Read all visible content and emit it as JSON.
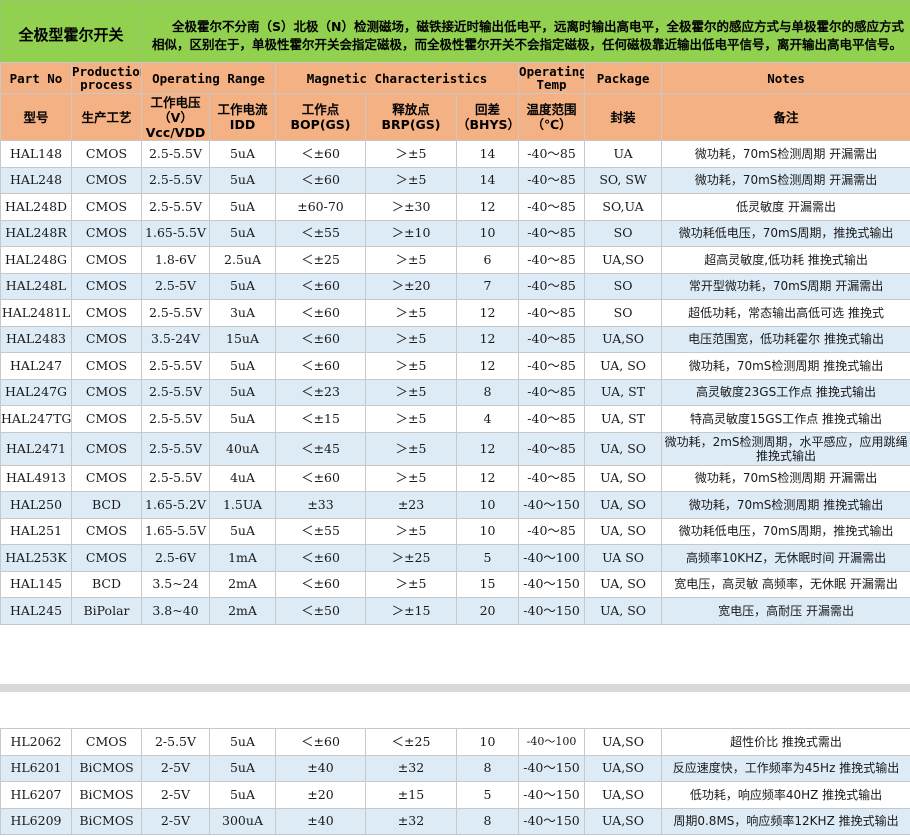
{
  "title": "全极型霍尔开关",
  "description": "全极霍尔不分南（S）北极（N）检测磁场，磁铁接近时输出低电平，远离时输出高电平，全极霍尔的感应方式与单极霍尔的感应方式相似，区别在于，单极性霍尔开关会指定磁极，而全极性霍尔开关不会指定磁极，任何磁极靠近输出低电平信号，离开输出高电平信号。",
  "header_en": {
    "part_no": "Part No",
    "production": "Production process",
    "operating_range": "Operating Range",
    "magnetic": "Magnetic Characteristics",
    "operating_temp": "Operating Temp",
    "package": "Package",
    "notes": "Notes"
  },
  "header_cn": {
    "part_no": "型号",
    "production": "生产工艺",
    "voltage": "工作电压（V）Vcc/VDD",
    "current": "工作电流IDD",
    "bop": "工作点BOP(GS)",
    "brp": "释放点BRP(GS)",
    "hys": "回差（BHYS）",
    "temp": "温度范围（℃）",
    "package": "封装",
    "notes": "备注"
  },
  "rows": [
    {
      "part": "HAL148",
      "proc": "CMOS",
      "volt": "2.5-5.5V",
      "curr": "5uA",
      "bop": "＜±60",
      "brp": "＞±5",
      "hys": "14",
      "temp": "-40～85",
      "pkg": "UA",
      "notes": "微功耗，70mS检测周期 开漏需出"
    },
    {
      "part": "HAL248",
      "proc": "CMOS",
      "volt": "2.5-5.5V",
      "curr": "5uA",
      "bop": "＜±60",
      "brp": "＞±5",
      "hys": "14",
      "temp": "-40～85",
      "pkg": "SO, SW",
      "notes": "微功耗，70mS检测周期 开漏需出"
    },
    {
      "part": "HAL248D",
      "proc": "CMOS",
      "volt": "2.5-5.5V",
      "curr": "5uA",
      "bop": "±60-70",
      "brp": "＞±30",
      "hys": "12",
      "temp": "-40～85",
      "pkg": "SO,UA",
      "notes": "低灵敏度  开漏需出"
    },
    {
      "part": "HAL248R",
      "proc": "CMOS",
      "volt": "1.65-5.5V",
      "curr": "5uA",
      "bop": "＜±55",
      "brp": "＞±10",
      "hys": "10",
      "temp": "-40～85",
      "pkg": "SO",
      "notes": "微功耗低电压，70mS周期，推挽式输出"
    },
    {
      "part": "HAL248G",
      "proc": "CMOS",
      "volt": "1.8-6V",
      "curr": "2.5uA",
      "bop": "＜±25",
      "brp": "＞±5",
      "hys": "6",
      "temp": "-40～85",
      "pkg": "UA,SO",
      "notes": "超高灵敏度,低功耗 推挽式输出"
    },
    {
      "part": "HAL248L",
      "proc": "CMOS",
      "volt": "2.5-5V",
      "curr": "5uA",
      "bop": "＜±60",
      "brp": "＞±20",
      "hys": "7",
      "temp": "-40～85",
      "pkg": "SO",
      "notes": "常开型微功耗，70mS周期 开漏需出"
    },
    {
      "part": "HAL2481L",
      "proc": "CMOS",
      "volt": "2.5-5.5V",
      "curr": "3uA",
      "bop": "＜±60",
      "brp": "＞±5",
      "hys": "12",
      "temp": "-40～85",
      "pkg": "SO",
      "notes": "超低功耗，常态输出高低可选 推挽式"
    },
    {
      "part": "HAL2483",
      "proc": "CMOS",
      "volt": "3.5-24V",
      "curr": "15uA",
      "bop": "＜±60",
      "brp": "＞±5",
      "hys": "12",
      "temp": "-40～85",
      "pkg": "UA,SO",
      "notes": "电压范围宽，低功耗霍尔 推挽式输出"
    },
    {
      "part": "HAL247",
      "proc": "CMOS",
      "volt": "2.5-5.5V",
      "curr": "5uA",
      "bop": "＜±60",
      "brp": "＞±5",
      "hys": "12",
      "temp": "-40～85",
      "pkg": "UA, SO",
      "notes": "微功耗，70mS检测周期 推挽式输出"
    },
    {
      "part": "HAL247G",
      "proc": "CMOS",
      "volt": "2.5-5.5V",
      "curr": "5uA",
      "bop": "＜±23",
      "brp": "＞±5",
      "hys": "8",
      "temp": "-40～85",
      "pkg": "UA, ST",
      "notes": "高灵敏度23GS工作点 推挽式输出"
    },
    {
      "part": "HAL247TG",
      "proc": "CMOS",
      "volt": "2.5-5.5V",
      "curr": "5uA",
      "bop": "＜±15",
      "brp": "＞±5",
      "hys": "4",
      "temp": "-40～85",
      "pkg": "UA, ST",
      "notes": "特高灵敏度15GS工作点 推挽式输出"
    },
    {
      "part": "HAL2471",
      "proc": "CMOS",
      "volt": "2.5-5.5V",
      "curr": "40uA",
      "bop": "＜±45",
      "brp": "＞±5",
      "hys": "12",
      "temp": "-40～85",
      "pkg": "UA, SO",
      "notes": "微功耗，2mS检测周期，水平感应，应用跳绳  推挽式输出"
    },
    {
      "part": "HAL4913",
      "proc": "CMOS",
      "volt": "2.5-5.5V",
      "curr": "4uA",
      "bop": "＜±60",
      "brp": "＞±5",
      "hys": "12",
      "temp": "-40～85",
      "pkg": "UA, SO",
      "notes": "微功耗，70mS检测周期   开漏需出"
    },
    {
      "part": "HAL250",
      "proc": "BCD",
      "volt": "1.65-5.2V",
      "curr": "1.5UA",
      "bop": "±33",
      "brp": "±23",
      "hys": "10",
      "temp": "-40～150",
      "pkg": "UA, SO",
      "notes": "微功耗，70mS检测周期 推挽式输出"
    },
    {
      "part": "HAL251",
      "proc": "CMOS",
      "volt": "1.65-5.5V",
      "curr": "5uA",
      "bop": "＜±55",
      "brp": "＞±5",
      "hys": "10",
      "temp": "-40～85",
      "pkg": "UA, SO",
      "notes": "微功耗低电压，70mS周期，推挽式输出"
    },
    {
      "part": "HAL253K",
      "proc": "CMOS",
      "volt": "2.5-6V",
      "curr": "1mA",
      "bop": "＜±60",
      "brp": "＞±25",
      "hys": "5",
      "temp": "-40～100",
      "pkg": "UA SO",
      "notes": "高频率10KHZ，无休眠时间 开漏需出"
    },
    {
      "part": "HAL145",
      "proc": "BCD",
      "volt": "3.5~24",
      "curr": "2mA",
      "bop": "＜±60",
      "brp": "＞±5",
      "hys": "15",
      "temp": "-40～150",
      "pkg": "UA, SO",
      "notes": "宽电压，高灵敏 高频率，无休眠 开漏需出"
    },
    {
      "part": "HAL245",
      "proc": "BiPolar",
      "volt": "3.8~40",
      "curr": "2mA",
      "bop": "＜±50",
      "brp": "＞±15",
      "hys": "20",
      "temp": "-40～150",
      "pkg": "UA, SO",
      "notes": "宽电压，高耐压 开漏需出"
    }
  ],
  "lower_rows": [
    {
      "part": "HL2062",
      "proc": "CMOS",
      "volt": "2-5.5V",
      "curr": "5uA",
      "bop": "＜±60",
      "brp": "＜±25",
      "hys": "10",
      "temp": "-40～100",
      "pkg": "UA,SO",
      "notes": "超性价比 推挽式需出"
    },
    {
      "part": "HL6201",
      "proc": "BiCMOS",
      "volt": "2-5V",
      "curr": "5uA",
      "bop": "±40",
      "brp": "±32",
      "hys": "8",
      "temp": "-40～150",
      "pkg": "UA,SO",
      "notes": "反应速度快，工作频率为45Hz 推挽式输出"
    },
    {
      "part": "HL6207",
      "proc": "BiCMOS",
      "volt": "2-5V",
      "curr": "5uA",
      "bop": "±20",
      "brp": "±15",
      "hys": "5",
      "temp": "-40～150",
      "pkg": "UA,SO",
      "notes": "低功耗，响应频率40HZ 推挽式输出"
    },
    {
      "part": "HL6209",
      "proc": "BiCMOS",
      "volt": "2-5V",
      "curr": "300uA",
      "bop": "±40",
      "brp": "±32",
      "hys": "8",
      "temp": "-40～150",
      "pkg": "UA,SO",
      "notes": "周期0.8MS，响应频率12KHZ 推挽式输出"
    }
  ]
}
